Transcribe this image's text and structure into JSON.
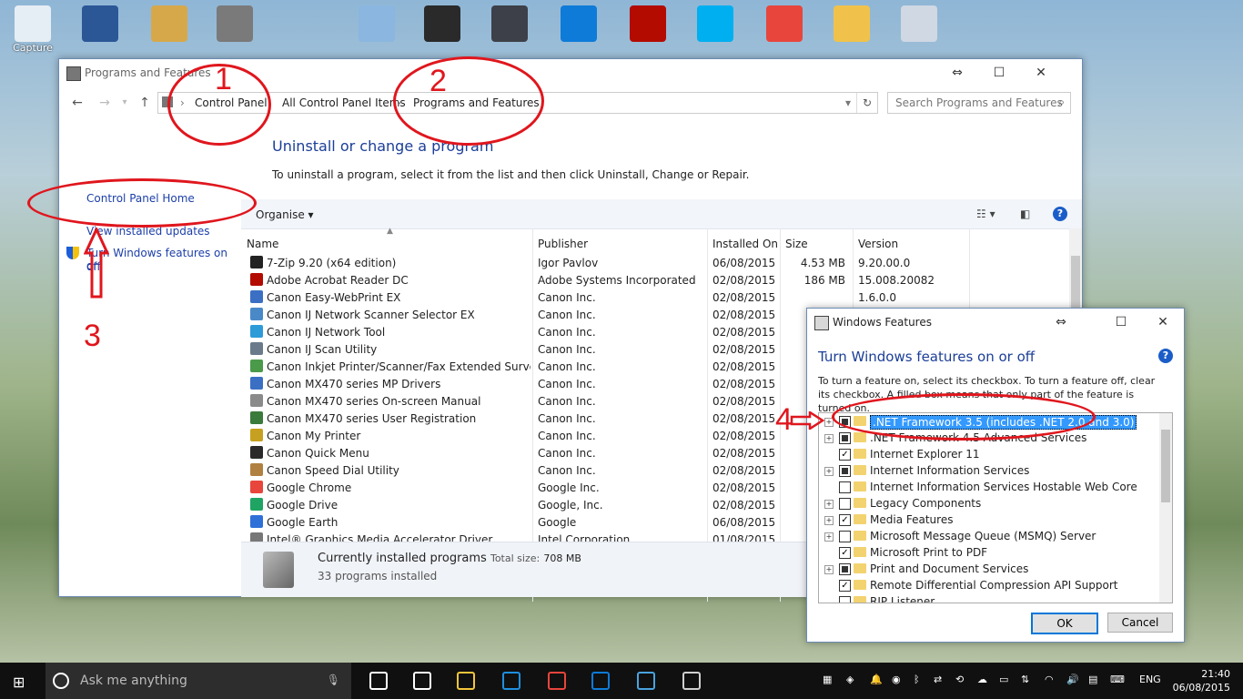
{
  "desktop": {
    "icons": [
      {
        "label": "Capture",
        "color": "#e6eef5"
      },
      {
        "label": "",
        "color": "#2b5797"
      },
      {
        "label": "",
        "color": "#d6a84a"
      },
      {
        "label": "",
        "color": "#7a7a7a"
      },
      {
        "label": "",
        "color": "#8ab6e0"
      },
      {
        "label": "",
        "color": "#2a2a2a"
      },
      {
        "label": "",
        "color": "#3d4048"
      },
      {
        "label": "",
        "color": "#0e7bd8"
      },
      {
        "label": "",
        "color": "#b30b00"
      },
      {
        "label": "",
        "color": "#00aff0"
      },
      {
        "label": "",
        "color": "#e8453c"
      },
      {
        "label": "",
        "color": "#f0c24b"
      },
      {
        "label": "",
        "color": "#cfd8e3"
      }
    ]
  },
  "control_panel": {
    "title": "Programs and Features",
    "breadcrumb": [
      "Control Panel",
      "All Control Panel Items",
      "Programs and Features"
    ],
    "search_placeholder": "Search Programs and Features",
    "left_links": {
      "home": "Control Panel Home",
      "updates": "View installed updates",
      "features_line1": "Turn Windows features on or",
      "features_line2": "off"
    },
    "heading": "Uninstall or change a program",
    "subheading": "To uninstall a program, select it from the list and then click Uninstall, Change or Repair.",
    "organise": "Organise",
    "columns": {
      "name": "Name",
      "publisher": "Publisher",
      "installed_on": "Installed On",
      "size": "Size",
      "version": "Version"
    },
    "programs": [
      {
        "name": "7-Zip 9.20 (x64 edition)",
        "publisher": "Igor Pavlov",
        "date": "06/08/2015",
        "size": "4.53 MB",
        "version": "9.20.00.0",
        "color": "#222"
      },
      {
        "name": "Adobe Acrobat Reader DC",
        "publisher": "Adobe Systems Incorporated",
        "date": "02/08/2015",
        "size": "186 MB",
        "version": "15.008.20082",
        "color": "#b30b00"
      },
      {
        "name": "Canon Easy-WebPrint EX",
        "publisher": "Canon Inc.",
        "date": "02/08/2015",
        "size": "",
        "version": "1.6.0.0",
        "color": "#3b6fc4"
      },
      {
        "name": "Canon IJ Network Scanner Selector EX",
        "publisher": "Canon Inc.",
        "date": "02/08/2015",
        "size": "",
        "version": "",
        "color": "#4a89c8"
      },
      {
        "name": "Canon IJ Network Tool",
        "publisher": "Canon Inc.",
        "date": "02/08/2015",
        "size": "",
        "version": "",
        "color": "#2d9bd8"
      },
      {
        "name": "Canon IJ Scan Utility",
        "publisher": "Canon Inc.",
        "date": "02/08/2015",
        "size": "",
        "version": "",
        "color": "#6a7a8a"
      },
      {
        "name": "Canon Inkjet Printer/Scanner/Fax Extended Survey Pr...",
        "publisher": "Canon Inc.",
        "date": "02/08/2015",
        "size": "",
        "version": "",
        "color": "#4a9a4a"
      },
      {
        "name": "Canon MX470 series MP Drivers",
        "publisher": "Canon Inc.",
        "date": "02/08/2015",
        "size": "",
        "version": "",
        "color": "#3b6fc4"
      },
      {
        "name": "Canon MX470 series On-screen Manual",
        "publisher": "Canon Inc.",
        "date": "02/08/2015",
        "size": "",
        "version": "",
        "color": "#8a8a8a"
      },
      {
        "name": "Canon MX470 series User Registration",
        "publisher": "Canon Inc.",
        "date": "02/08/2015",
        "size": "",
        "version": "",
        "color": "#3a7a3a"
      },
      {
        "name": "Canon My Printer",
        "publisher": "Canon Inc.",
        "date": "02/08/2015",
        "size": "",
        "version": "",
        "color": "#c6a020"
      },
      {
        "name": "Canon Quick Menu",
        "publisher": "Canon Inc.",
        "date": "02/08/2015",
        "size": "",
        "version": "",
        "color": "#2a2a2a"
      },
      {
        "name": "Canon Speed Dial Utility",
        "publisher": "Canon Inc.",
        "date": "02/08/2015",
        "size": "",
        "version": "",
        "color": "#b08040"
      },
      {
        "name": "Google Chrome",
        "publisher": "Google Inc.",
        "date": "02/08/2015",
        "size": "",
        "version": "",
        "color": "#e8453c"
      },
      {
        "name": "Google Drive",
        "publisher": "Google, Inc.",
        "date": "02/08/2015",
        "size": "",
        "version": "",
        "color": "#1fa463"
      },
      {
        "name": "Google Earth",
        "publisher": "Google",
        "date": "06/08/2015",
        "size": "",
        "version": "",
        "color": "#2f6fd8"
      },
      {
        "name": "Intel® Graphics Media Accelerator Driver",
        "publisher": "Intel Corporation",
        "date": "01/08/2015",
        "size": "",
        "version": "",
        "color": "#777"
      }
    ],
    "status": {
      "title": "Currently installed programs",
      "total_label": "Total size:",
      "total_value": "708 MB",
      "count": "33 programs installed"
    }
  },
  "windows_features": {
    "title": "Windows Features",
    "heading": "Turn Windows features on or off",
    "description": "To turn a feature on, select its checkbox. To turn a feature off, clear its checkbox. A filled box means that only part of the feature is turned on.",
    "features": [
      {
        "label": ".NET Framework 3.5 (includes .NET 2.0 and 3.0)",
        "state": "partial",
        "expandable": true,
        "selected": true
      },
      {
        "label": ".NET Framework 4.5 Advanced Services",
        "state": "partial",
        "expandable": true,
        "selected": false
      },
      {
        "label": "Internet Explorer 11",
        "state": "checked",
        "expandable": false,
        "selected": false
      },
      {
        "label": "Internet Information Services",
        "state": "partial",
        "expandable": true,
        "selected": false
      },
      {
        "label": "Internet Information Services Hostable Web Core",
        "state": "unchecked",
        "expandable": false,
        "selected": false
      },
      {
        "label": "Legacy Components",
        "state": "unchecked",
        "expandable": true,
        "selected": false
      },
      {
        "label": "Media Features",
        "state": "checked",
        "expandable": true,
        "selected": false
      },
      {
        "label": "Microsoft Message Queue (MSMQ) Server",
        "state": "unchecked",
        "expandable": true,
        "selected": false
      },
      {
        "label": "Microsoft Print to PDF",
        "state": "checked",
        "expandable": false,
        "selected": false
      },
      {
        "label": "Print and Document Services",
        "state": "partial",
        "expandable": true,
        "selected": false
      },
      {
        "label": "Remote Differential Compression API Support",
        "state": "checked",
        "expandable": false,
        "selected": false
      },
      {
        "label": "RIP Listener",
        "state": "unchecked",
        "expandable": false,
        "selected": false
      }
    ],
    "ok": "OK",
    "cancel": "Cancel"
  },
  "annotations": {
    "n1": "1",
    "n2": "2",
    "n3": "3",
    "n4": "4",
    "color": "#e0161d"
  },
  "taskbar": {
    "search_placeholder": "Ask me anything",
    "language": "ENG",
    "time": "21:40",
    "date": "06/08/2015",
    "pinned": [
      {
        "name": "task-view",
        "color": "#ffffff"
      },
      {
        "name": "store",
        "color": "#ffffff"
      },
      {
        "name": "file-explorer",
        "color": "#f3c53b"
      },
      {
        "name": "edge",
        "color": "#1e8fe0"
      },
      {
        "name": "chrome",
        "color": "#e8453c"
      },
      {
        "name": "teamviewer",
        "color": "#0e7bd8"
      },
      {
        "name": "control-panel",
        "color": "#4aa3df"
      },
      {
        "name": "installer",
        "color": "#cfcfcf"
      }
    ]
  }
}
